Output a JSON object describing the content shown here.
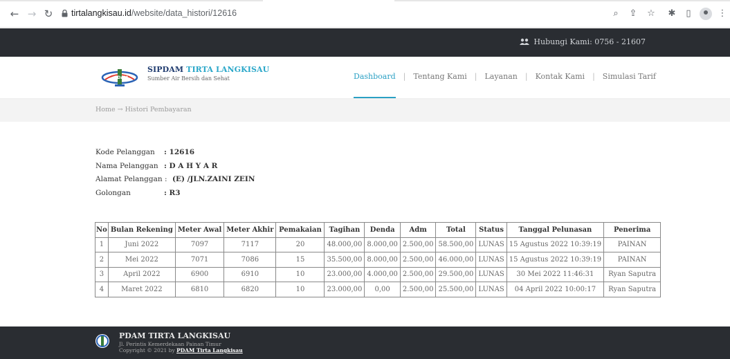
{
  "browser": {
    "url_host": "tirtalangkisau.id",
    "url_path": "/website/data_histori/12616"
  },
  "topbar": {
    "contact": "Hubungi Kami: 0756 - 21607"
  },
  "header": {
    "brand_main": "SIPDAM",
    "brand_highlight": "TIRTA LANGKISAU",
    "brand_sub": "Sumber Air Bersih dan Sehat",
    "logo_text": "PDAM",
    "menu": [
      {
        "label": "Dashboard"
      },
      {
        "label": "Tentang Kami"
      },
      {
        "label": "Layanan"
      },
      {
        "label": "Kontak Kami"
      },
      {
        "label": "Simulasi Tarif"
      }
    ]
  },
  "breadcrumb": "Home → Histori Pembayaran",
  "customer": {
    "kode_label": "Kode Pelanggan",
    "kode_value": ": 12616",
    "nama_label": "Nama Pelanggan",
    "nama_value": ": D A H Y A R",
    "alamat_label": "Alamat Pelanggan :",
    "alamat_value": "(E) /JLN.ZAINI ZEIN",
    "golongan_label": "Golongan",
    "golongan_value": ": R3"
  },
  "table": {
    "headers": [
      "No",
      "Bulan Rekening",
      "Meter Awal",
      "Meter Akhir",
      "Pemakaian",
      "Tagihan",
      "Denda",
      "Adm",
      "Total",
      "Status",
      "Tanggal Pelunasan",
      "Penerima"
    ],
    "rows": [
      [
        "1",
        "Juni 2022",
        "7097",
        "7117",
        "20",
        "48.000,00",
        "8.000,00",
        "2.500,00",
        "58.500,00",
        "LUNAS",
        "15 Agustus 2022 10:39:19",
        "PAINAN"
      ],
      [
        "2",
        "Mei 2022",
        "7071",
        "7086",
        "15",
        "35.500,00",
        "8.000,00",
        "2.500,00",
        "46.000,00",
        "LUNAS",
        "15 Agustus 2022 10:39:19",
        "PAINAN"
      ],
      [
        "3",
        "April 2022",
        "6900",
        "6910",
        "10",
        "23.000,00",
        "4.000,00",
        "2.500,00",
        "29.500,00",
        "LUNAS",
        "30 Mei 2022 11:46:31",
        "Ryan Saputra"
      ],
      [
        "4",
        "Maret 2022",
        "6810",
        "6820",
        "10",
        "23.000,00",
        "0,00",
        "2.500,00",
        "25.500,00",
        "LUNAS",
        "04 April 2022 10:00:17",
        "Ryan Saputra"
      ]
    ]
  },
  "footer": {
    "title": "PDAM TIRTA LANGKISAU",
    "address": "Jl. Perintis Kemerdekaan Painan Timur",
    "copyright_prefix": "Copyright © 2021 by ",
    "copyright_link": "PDAM Tirta Langkisau"
  }
}
